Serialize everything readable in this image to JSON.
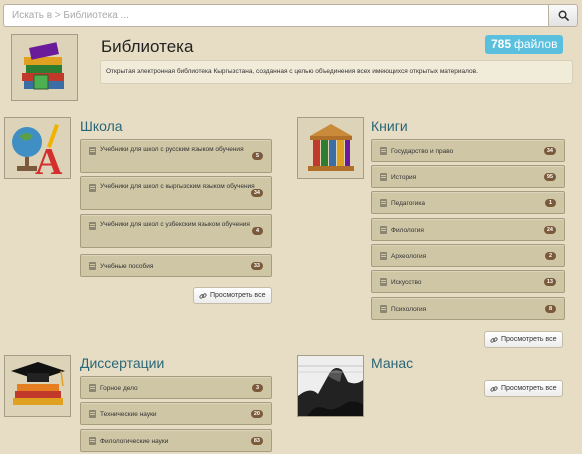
{
  "search": {
    "placeholder": "Искать в > Библиотека ..."
  },
  "header": {
    "title": "Библиотека",
    "files_count": "785",
    "files_label": "файлов",
    "description": "Открытая электронная библиотека Кыргызстана, созданная с целью объединения всех имеющихся открытых материалов."
  },
  "sections": {
    "school": {
      "title": "Школа",
      "items": [
        {
          "label": "Учебники для школ с русским языком обучения",
          "count": "5"
        },
        {
          "label": "Учебники для школ с кыргызским языком обучения",
          "count": "34"
        },
        {
          "label": "Учебники для школ с узбекским языком обучения",
          "count": "4"
        },
        {
          "label": "Учебные пособия",
          "count": "33"
        }
      ],
      "view_all": "Просмотреть все"
    },
    "books": {
      "title": "Книги",
      "items": [
        {
          "label": "Государство и право",
          "count": "34"
        },
        {
          "label": "История",
          "count": "95"
        },
        {
          "label": "Педагогика",
          "count": "1"
        },
        {
          "label": "Филология",
          "count": "24"
        },
        {
          "label": "Археология",
          "count": "2"
        },
        {
          "label": "Искусство",
          "count": "13"
        },
        {
          "label": "Психология",
          "count": "8"
        }
      ],
      "view_all": "Просмотреть все"
    },
    "dissertations": {
      "title": "Диссертации",
      "items": [
        {
          "label": "Горное дело",
          "count": "3"
        },
        {
          "label": "Технические науки",
          "count": "20"
        },
        {
          "label": "Филологические науки",
          "count": "83"
        }
      ]
    },
    "manas": {
      "title": "Манас",
      "view_all": "Просмотреть все"
    }
  }
}
